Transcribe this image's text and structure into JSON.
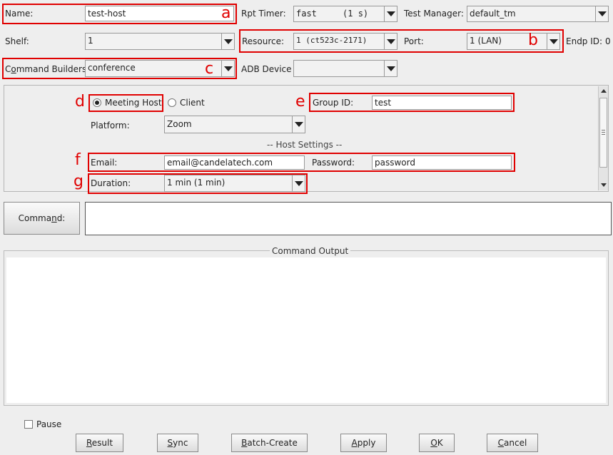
{
  "fields": {
    "name": {
      "label": "Name:",
      "value": "test-host",
      "annot": "a"
    },
    "rpt_timer": {
      "label": "Rpt Timer:",
      "value": "fast     (1 s)"
    },
    "test_manager": {
      "label": "Test Manager:",
      "value": "default_tm"
    },
    "shelf": {
      "label": "Shelf:",
      "value": "1"
    },
    "resource": {
      "label": "Resource:",
      "value": "1 (ct523c-2171)"
    },
    "port": {
      "label": "Port:",
      "value": "1 (LAN)",
      "annot": "b"
    },
    "endp_id": {
      "label": "Endp ID:",
      "value": "0"
    },
    "command_builders": {
      "label_pre": "C",
      "label_u": "o",
      "label_post": "mmand Builders",
      "value": "conference",
      "annot": "c"
    },
    "adb_device": {
      "label": "ADB Device",
      "value": ""
    }
  },
  "builder": {
    "role_meeting_host": "Meeting Host",
    "role_client": "Client",
    "role_annot": "d",
    "group_id": {
      "label": "Group ID:",
      "value": "test",
      "annot": "e"
    },
    "platform": {
      "label": "Platform:",
      "value": "Zoom"
    },
    "host_settings_title": "-- Host Settings --",
    "email": {
      "label": "Email:",
      "value": "email@candelatech.com",
      "annot": "f"
    },
    "password": {
      "label": "Password:",
      "value": "password"
    },
    "duration": {
      "label": "Duration:",
      "value": "1 min (1 min)",
      "annot": "g"
    }
  },
  "command": {
    "button_pre": "Comma",
    "button_u": "n",
    "button_post": "d:",
    "value": ""
  },
  "output": {
    "title": "Command Output",
    "text": ""
  },
  "pause_label": "Pause",
  "buttons": {
    "result": {
      "u": "R",
      "rest": "esult"
    },
    "sync": {
      "u": "S",
      "rest": "ync"
    },
    "batch": {
      "u": "B",
      "rest": "atch-Create"
    },
    "apply": {
      "u": "A",
      "rest": "pply"
    },
    "ok": {
      "u": "O",
      "rest": "K"
    },
    "cancel": {
      "u": "C",
      "rest": "ancel"
    }
  }
}
